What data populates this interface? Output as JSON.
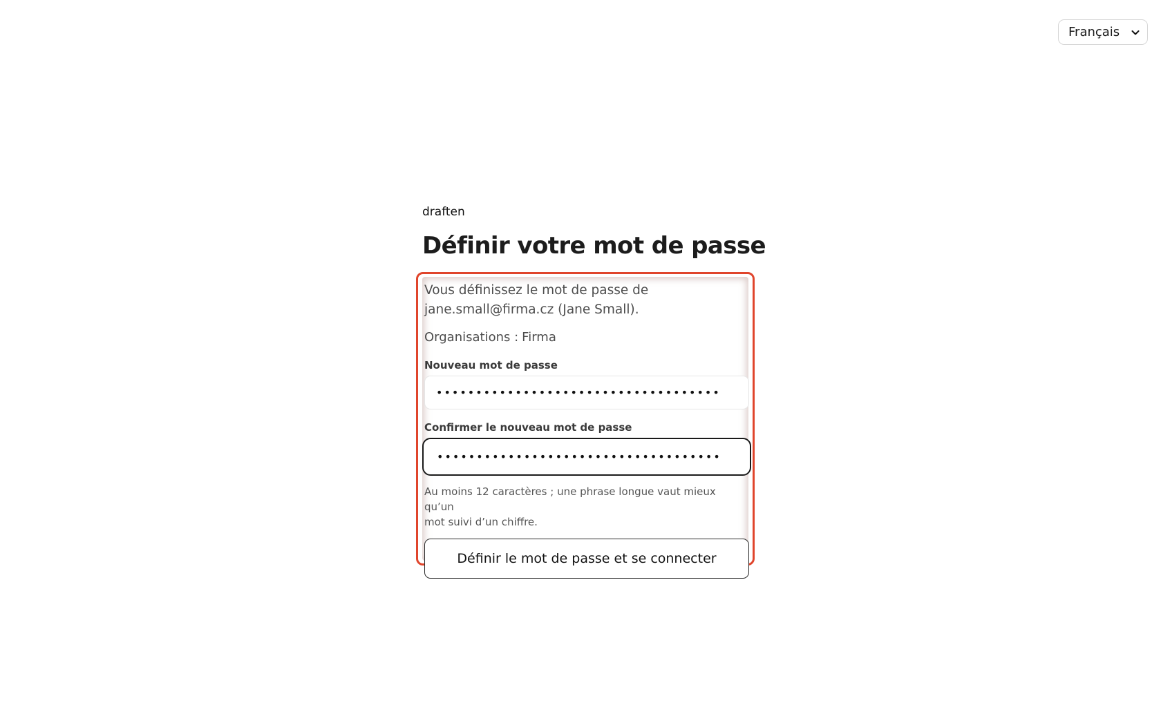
{
  "language_select": {
    "selected": "Français",
    "icon": "chevron-down-icon"
  },
  "brand": "draften",
  "page_title": "Définir votre mot de passe",
  "intro": {
    "line1": "Vous définissez le mot de passe de",
    "line2": "jane.small@firma.cz (Jane Small)."
  },
  "organizations": {
    "label": "Organisations :",
    "value": "Firma"
  },
  "new_password": {
    "label": "Nouveau mot de passe",
    "value": "••••••••••••••••••••••••••••••••••••"
  },
  "confirm_password": {
    "label": "Confirmer le nouveau mot de passe",
    "value": "••••••••••••••••••••••••••••••••••••"
  },
  "hint": {
    "line1": "Au moins 12 caractères ; une phrase longue vaut mieux qu’un",
    "line2": "mot suivi d’un chiffre."
  },
  "submit_label": "Définir le mot de passe et se connecter",
  "colors": {
    "highlight_border": "#e0452c",
    "text_primary": "#1a1a1a",
    "text_muted": "#4d4d4d"
  }
}
